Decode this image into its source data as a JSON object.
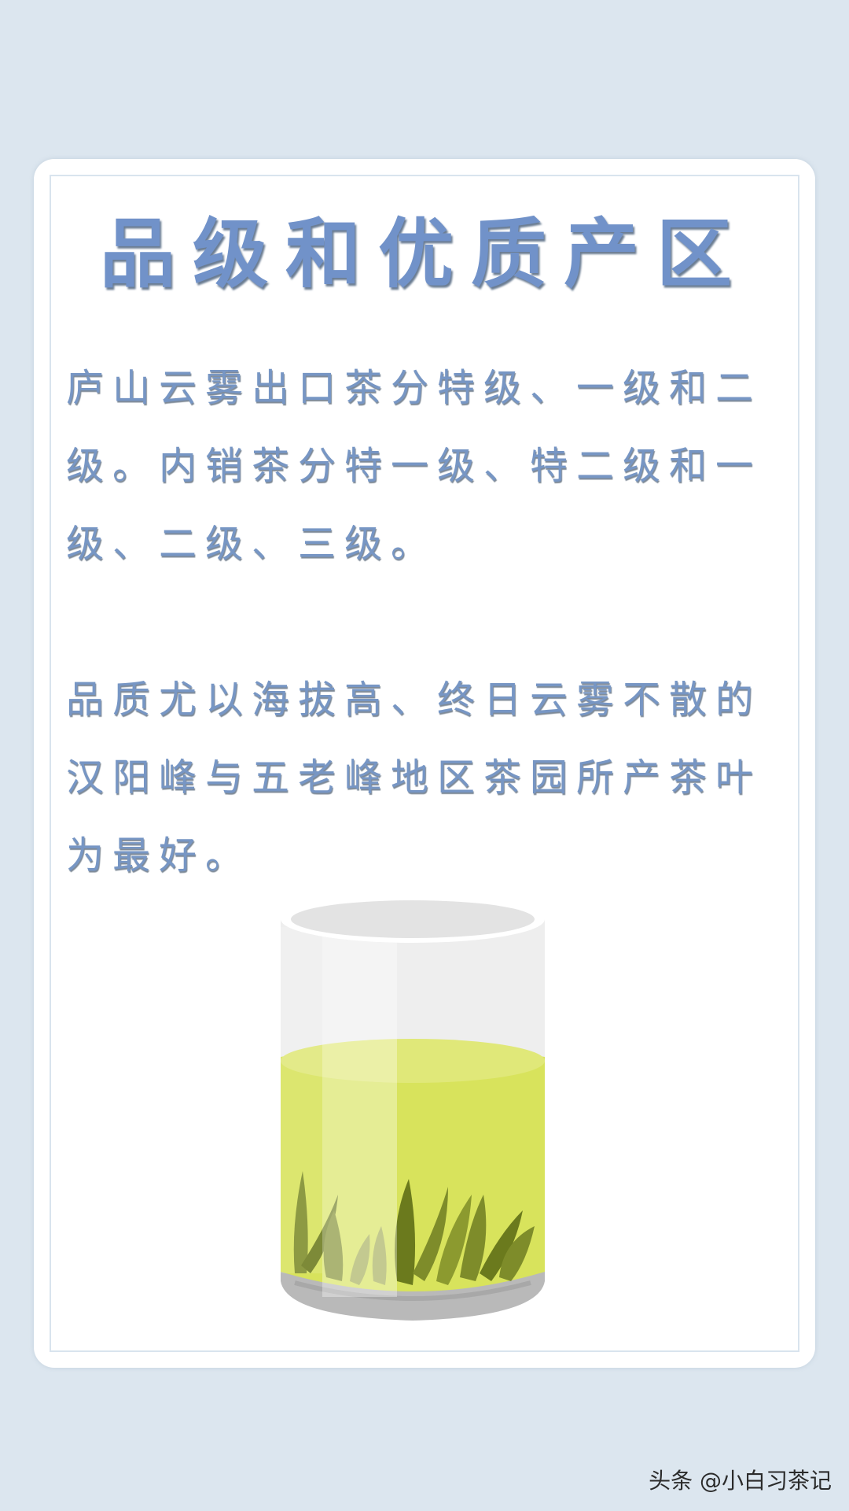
{
  "title": "品级和优质产区",
  "paragraphs": [
    "庐山云雾出口茶分特级、一级和二级。内销茶分特一级、特二级和一级、二级、三级。",
    "品质尤以海拔高、终日云雾不散的汉阳峰与五老峰地区茶园所产茶叶为最好。"
  ],
  "illustration": "glass-of-green-tea",
  "watermark": "头条 @小白习茶记",
  "colors": {
    "background": "#dce6ef",
    "card": "#ffffff",
    "text": "#7796c4",
    "tea": "#d8e35c",
    "leaf": "#7a8a2a"
  }
}
